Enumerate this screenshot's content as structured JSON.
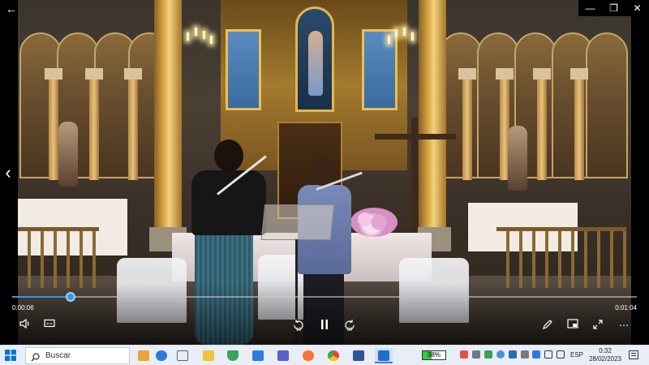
{
  "window": {
    "back_glyph": "←",
    "minimize_glyph": "—",
    "maximize_glyph": "❐",
    "close_glyph": "✕"
  },
  "player": {
    "current_time": "0:00:06",
    "duration": "0:01:04",
    "progress": 0.094,
    "skip_back_seconds": "10",
    "skip_forward_seconds": "30",
    "accent_color": "#3a96dd",
    "prev_glyph": "‹",
    "more_glyph": "⋯"
  },
  "taskbar": {
    "search_placeholder": "Buscar",
    "battery_percent": "38%",
    "battery_level": 0.38,
    "language": "ESP",
    "time": "0:32",
    "date": "28/02/2023",
    "apps": [
      {
        "name": "widgets",
        "color": "#e8a33a"
      },
      {
        "name": "bluetooth-share",
        "color": "#2f7ad9"
      },
      {
        "name": "task-view",
        "color": "#5a6272"
      },
      {
        "name": "file-explorer",
        "color": "#f2c23c"
      },
      {
        "name": "security",
        "color": "#3aa35a"
      },
      {
        "name": "mail",
        "color": "#2a7de1"
      },
      {
        "name": "teams",
        "color": "#5b5fc7"
      },
      {
        "name": "firefox",
        "color": "#ff7139"
      },
      {
        "name": "chrome",
        "color": "#34a853"
      },
      {
        "name": "word",
        "color": "#2b579a"
      },
      {
        "name": "movies-tv",
        "color": "#1f6fd1"
      }
    ]
  }
}
